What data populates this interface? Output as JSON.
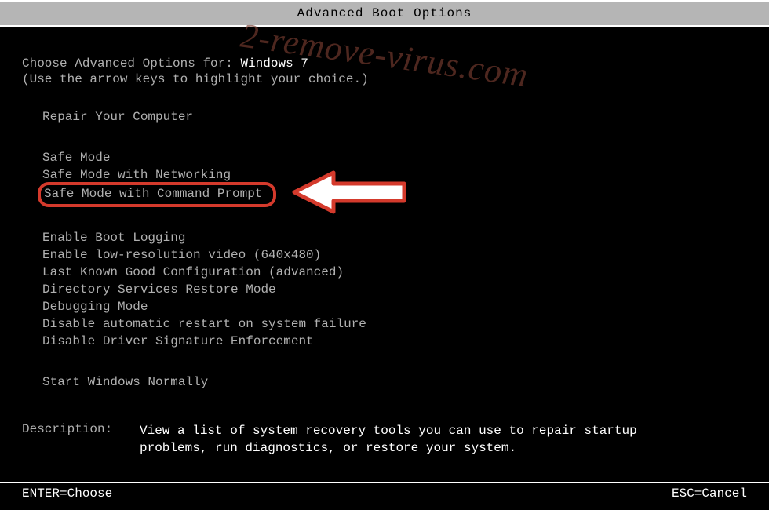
{
  "title": "Advanced Boot Options",
  "choose_prefix": "Choose Advanced Options for: ",
  "os_name": "Windows 7",
  "hint": "(Use the arrow keys to highlight your choice.)",
  "repair": "Repair Your Computer",
  "menu": {
    "safe_mode": "Safe Mode",
    "safe_mode_net": "Safe Mode with Networking",
    "safe_mode_cmd": "Safe Mode with Command Prompt",
    "boot_log": "Enable Boot Logging",
    "low_res": "Enable low-resolution video (640x480)",
    "lkg": "Last Known Good Configuration (advanced)",
    "ds_restore": "Directory Services Restore Mode",
    "debug": "Debugging Mode",
    "no_auto_restart": "Disable automatic restart on system failure",
    "no_sig_enf": "Disable Driver Signature Enforcement",
    "start_normal": "Start Windows Normally"
  },
  "description_label": "Description:",
  "description_text": "View a list of system recovery tools you can use to repair startup problems, run diagnostics, or restore your system.",
  "footer": {
    "enter": "ENTER=Choose",
    "esc": "ESC=Cancel"
  },
  "watermark": "2-remove-virus.com",
  "annotation": {
    "highlighted_item": "safe_mode_cmd",
    "arrow_color": "#ffffff",
    "arrow_outline": "#d43a2c"
  }
}
